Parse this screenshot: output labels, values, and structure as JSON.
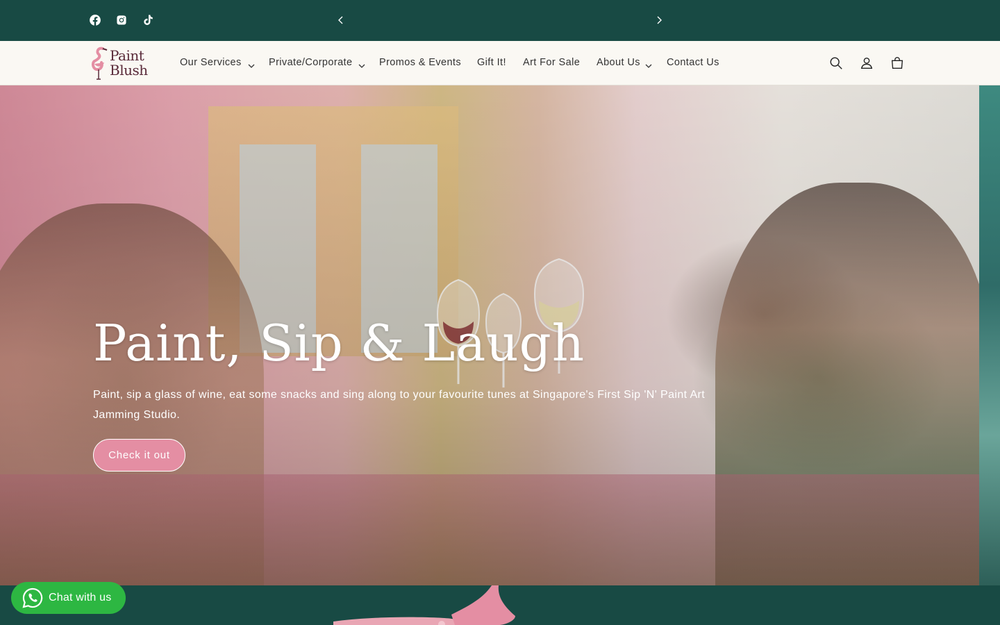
{
  "topbar": {
    "social": [
      "facebook-icon",
      "instagram-icon",
      "tiktok-icon"
    ],
    "prev_icon": "chevron-left-icon",
    "next_icon": "chevron-right-icon",
    "announcement": ""
  },
  "header": {
    "logo_line1": "Paint",
    "logo_line2": "Blush",
    "nav": [
      {
        "label": "Our Services",
        "dropdown": true
      },
      {
        "label": "Private/Corporate",
        "dropdown": true
      },
      {
        "label": "Promos & Events",
        "dropdown": false
      },
      {
        "label": "Gift It!",
        "dropdown": false
      },
      {
        "label": "Art For Sale",
        "dropdown": false
      },
      {
        "label": "About Us",
        "dropdown": true
      },
      {
        "label": "Contact Us",
        "dropdown": false
      }
    ],
    "icons": [
      "search-icon",
      "account-icon",
      "cart-icon"
    ]
  },
  "hero": {
    "title": "Paint, Sip & Laugh",
    "subtitle": "Paint, sip a glass of wine, eat some snacks and sing along to your favourite tunes at Singapore's First Sip 'N' Paint Art Jamming Studio.",
    "button_label": "Check it out"
  },
  "chat": {
    "label": "Chat with us",
    "icon": "whatsapp-icon"
  },
  "colors": {
    "primary": "#184a44",
    "accent": "#e48ea3",
    "header_bg": "#faf8f3",
    "chat": "#2db742"
  }
}
